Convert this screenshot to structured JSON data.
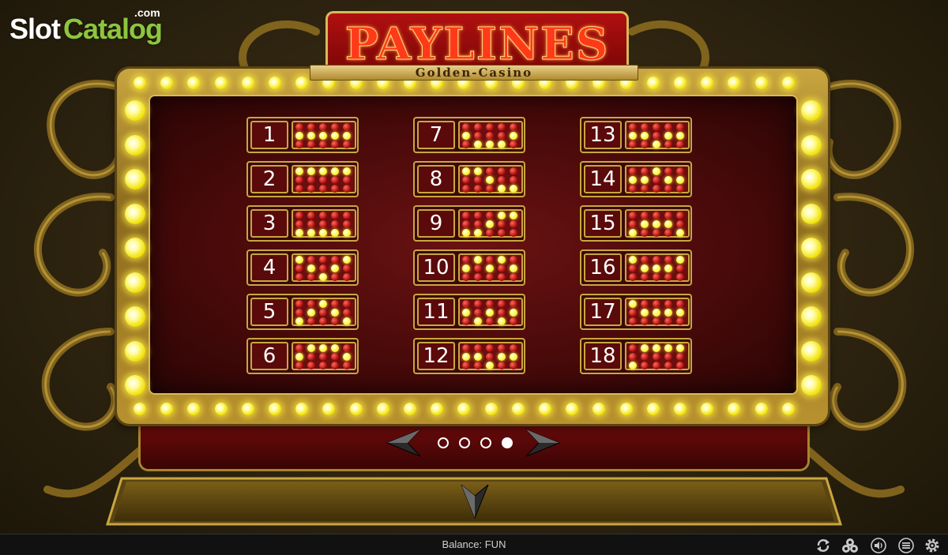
{
  "watermark": {
    "slot": "Slot",
    "catalog": "Catalog",
    "com": ".com"
  },
  "header": {
    "title": "PAYLINES",
    "subtitle": "Golden-Casino"
  },
  "paylines": [
    {
      "number": "1",
      "pattern": [
        [
          0,
          0,
          0,
          0,
          0
        ],
        [
          1,
          1,
          1,
          1,
          1
        ],
        [
          0,
          0,
          0,
          0,
          0
        ]
      ]
    },
    {
      "number": "2",
      "pattern": [
        [
          1,
          1,
          1,
          1,
          1
        ],
        [
          0,
          0,
          0,
          0,
          0
        ],
        [
          0,
          0,
          0,
          0,
          0
        ]
      ]
    },
    {
      "number": "3",
      "pattern": [
        [
          0,
          0,
          0,
          0,
          0
        ],
        [
          0,
          0,
          0,
          0,
          0
        ],
        [
          1,
          1,
          1,
          1,
          1
        ]
      ]
    },
    {
      "number": "4",
      "pattern": [
        [
          1,
          0,
          0,
          0,
          1
        ],
        [
          0,
          1,
          0,
          1,
          0
        ],
        [
          0,
          0,
          1,
          0,
          0
        ]
      ]
    },
    {
      "number": "5",
      "pattern": [
        [
          0,
          0,
          1,
          0,
          0
        ],
        [
          0,
          1,
          0,
          1,
          0
        ],
        [
          1,
          0,
          0,
          0,
          1
        ]
      ]
    },
    {
      "number": "6",
      "pattern": [
        [
          0,
          1,
          1,
          1,
          0
        ],
        [
          1,
          0,
          0,
          0,
          1
        ],
        [
          0,
          0,
          0,
          0,
          0
        ]
      ]
    },
    {
      "number": "7",
      "pattern": [
        [
          0,
          0,
          0,
          0,
          0
        ],
        [
          1,
          0,
          0,
          0,
          1
        ],
        [
          0,
          1,
          1,
          1,
          0
        ]
      ]
    },
    {
      "number": "8",
      "pattern": [
        [
          1,
          1,
          0,
          0,
          0
        ],
        [
          0,
          0,
          1,
          0,
          0
        ],
        [
          0,
          0,
          0,
          1,
          1
        ]
      ]
    },
    {
      "number": "9",
      "pattern": [
        [
          0,
          0,
          0,
          1,
          1
        ],
        [
          0,
          0,
          1,
          0,
          0
        ],
        [
          1,
          1,
          0,
          0,
          0
        ]
      ]
    },
    {
      "number": "10",
      "pattern": [
        [
          0,
          1,
          0,
          1,
          0
        ],
        [
          1,
          0,
          1,
          0,
          1
        ],
        [
          0,
          0,
          0,
          0,
          0
        ]
      ]
    },
    {
      "number": "11",
      "pattern": [
        [
          0,
          0,
          0,
          0,
          0
        ],
        [
          1,
          0,
          1,
          0,
          1
        ],
        [
          0,
          1,
          0,
          1,
          0
        ]
      ]
    },
    {
      "number": "12",
      "pattern": [
        [
          0,
          0,
          0,
          0,
          0
        ],
        [
          1,
          1,
          0,
          1,
          1
        ],
        [
          0,
          0,
          1,
          0,
          0
        ]
      ]
    },
    {
      "number": "13",
      "pattern": [
        [
          0,
          0,
          0,
          0,
          0
        ],
        [
          1,
          1,
          0,
          1,
          1
        ],
        [
          0,
          0,
          1,
          0,
          0
        ]
      ]
    },
    {
      "number": "14",
      "pattern": [
        [
          0,
          0,
          1,
          0,
          0
        ],
        [
          1,
          1,
          0,
          1,
          1
        ],
        [
          0,
          0,
          0,
          0,
          0
        ]
      ]
    },
    {
      "number": "15",
      "pattern": [
        [
          0,
          0,
          0,
          0,
          0
        ],
        [
          0,
          1,
          1,
          1,
          0
        ],
        [
          1,
          0,
          0,
          0,
          1
        ]
      ]
    },
    {
      "number": "16",
      "pattern": [
        [
          1,
          0,
          0,
          0,
          1
        ],
        [
          0,
          1,
          1,
          1,
          0
        ],
        [
          0,
          0,
          0,
          0,
          0
        ]
      ]
    },
    {
      "number": "17",
      "pattern": [
        [
          1,
          0,
          0,
          0,
          0
        ],
        [
          0,
          1,
          1,
          1,
          1
        ],
        [
          0,
          0,
          0,
          0,
          0
        ]
      ]
    },
    {
      "number": "18",
      "pattern": [
        [
          0,
          1,
          1,
          1,
          1
        ],
        [
          0,
          0,
          0,
          0,
          0
        ],
        [
          1,
          0,
          0,
          0,
          0
        ]
      ]
    }
  ],
  "pagination": {
    "total": 4,
    "active": 4,
    "prev_icon": "chevron-left-icon",
    "next_icon": "chevron-right-icon"
  },
  "close_icon": "chevron-down-icon",
  "status": {
    "balance": "Balance: FUN",
    "icons": [
      "refresh-icon",
      "chips-icon",
      "sound-icon",
      "menu-icon",
      "settings-icon"
    ]
  },
  "colors": {
    "gold": "#c9a640",
    "bulb": "#f0e000",
    "red": "#6a0e0e"
  }
}
